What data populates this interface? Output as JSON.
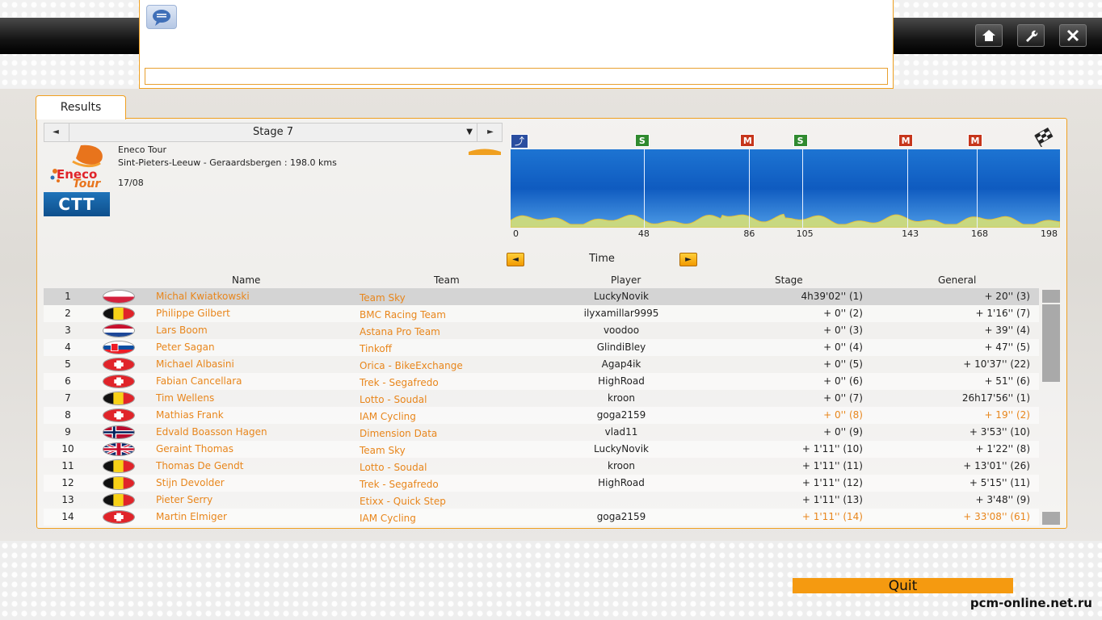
{
  "colors": {
    "accent": "#f0a020",
    "link": "#e8861c",
    "quit_bg": "#f59a10",
    "ctt_bg": "#1567aa"
  },
  "topbar": {
    "home_icon": "home-icon",
    "settings_icon": "wrench-icon",
    "close_icon": "close-icon"
  },
  "chat": {
    "icon": "chat-bubble-icon",
    "input_value": ""
  },
  "tabs": {
    "results": "Results"
  },
  "stage_selector": {
    "prev": "◄",
    "label": "Stage 7",
    "dropdown": "▼",
    "next": "►"
  },
  "race": {
    "logo_top": "Eneco",
    "logo_bottom": "Tour",
    "name": "Eneco Tour",
    "route": "Sint-Pieters-Leeuw - Geraardsbergen : 198.0 kms",
    "date": "17/08",
    "stage_type": "CTT"
  },
  "profile": {
    "markers": [
      {
        "type": "S",
        "km": 48
      },
      {
        "type": "M",
        "km": 86
      },
      {
        "type": "S",
        "km": 105
      },
      {
        "type": "M",
        "km": 143
      },
      {
        "type": "M",
        "km": 168
      }
    ],
    "km_labels": [
      "0",
      "48",
      "86",
      "105",
      "143",
      "168",
      "198"
    ],
    "start_icon": "time-trial-start-icon",
    "finish_icon": "checkered-flag-icon"
  },
  "classification": {
    "prev": "◄",
    "label": "Time",
    "next": "►"
  },
  "columns": {
    "name": "Name",
    "team": "Team",
    "player": "Player",
    "stage": "Stage",
    "general": "General"
  },
  "rows": [
    {
      "pos": "1",
      "flag": "PL",
      "name": "Michal Kwiatkowski",
      "team": "Team Sky",
      "player": "LuckyNovik",
      "stage": "4h39'02'' (1)",
      "general": "+ 20'' (3)",
      "highlight": false
    },
    {
      "pos": "2",
      "flag": "BE",
      "name": "Philippe Gilbert",
      "team": "BMC Racing Team",
      "player": "ilyxamillar9995",
      "stage": "+ 0'' (2)",
      "general": "+ 1'16'' (7)",
      "highlight": false
    },
    {
      "pos": "3",
      "flag": "NL",
      "name": "Lars Boom",
      "team": "Astana Pro Team",
      "player": "voodoo",
      "stage": "+ 0'' (3)",
      "general": "+ 39'' (4)",
      "highlight": false
    },
    {
      "pos": "4",
      "flag": "SK",
      "name": "Peter Sagan",
      "team": "Tinkoff",
      "player": "GlindiBley",
      "stage": "+ 0'' (4)",
      "general": "+ 47'' (5)",
      "highlight": false
    },
    {
      "pos": "5",
      "flag": "CH",
      "name": "Michael Albasini",
      "team": "Orica - BikeExchange",
      "player": "Agap4ik",
      "stage": "+ 0'' (5)",
      "general": "+ 10'37'' (22)",
      "highlight": false
    },
    {
      "pos": "6",
      "flag": "CH",
      "name": "Fabian Cancellara",
      "team": "Trek - Segafredo",
      "player": "HighRoad",
      "stage": "+ 0'' (6)",
      "general": "+ 51'' (6)",
      "highlight": false
    },
    {
      "pos": "7",
      "flag": "BE",
      "name": "Tim  Wellens",
      "team": "Lotto - Soudal",
      "player": "kroon",
      "stage": "+ 0'' (7)",
      "general": "26h17'56'' (1)",
      "highlight": false
    },
    {
      "pos": "8",
      "flag": "CH",
      "name": "Mathias Frank",
      "team": "IAM Cycling",
      "player": "goga2159",
      "stage": "+ 0'' (8)",
      "general": "+ 19'' (2)",
      "highlight": true
    },
    {
      "pos": "9",
      "flag": "NO",
      "name": "Edvald Boasson Hagen",
      "team": "Dimension Data",
      "player": "vlad11",
      "stage": "+ 0'' (9)",
      "general": "+ 3'53'' (10)",
      "highlight": false
    },
    {
      "pos": "10",
      "flag": "GB",
      "name": "Geraint Thomas",
      "team": "Team Sky",
      "player": "LuckyNovik",
      "stage": "+ 1'11'' (10)",
      "general": "+ 1'22'' (8)",
      "highlight": false
    },
    {
      "pos": "11",
      "flag": "BE",
      "name": "Thomas De Gendt",
      "team": "Lotto - Soudal",
      "player": "kroon",
      "stage": "+ 1'11'' (11)",
      "general": "+ 13'01'' (26)",
      "highlight": false
    },
    {
      "pos": "12",
      "flag": "BE",
      "name": "Stijn Devolder",
      "team": "Trek - Segafredo",
      "player": "HighRoad",
      "stage": "+ 1'11'' (12)",
      "general": "+ 5'15'' (11)",
      "highlight": false
    },
    {
      "pos": "13",
      "flag": "BE",
      "name": "Pieter Serry",
      "team": "Etixx - Quick Step",
      "player": "",
      "stage": "+ 1'11'' (13)",
      "general": "+ 3'48'' (9)",
      "highlight": false
    },
    {
      "pos": "14",
      "flag": "CH",
      "name": "Martin Elmiger",
      "team": "IAM Cycling",
      "player": "goga2159",
      "stage": "+ 1'11'' (14)",
      "general": "+ 33'08'' (61)",
      "highlight": true
    }
  ],
  "footer": {
    "quit": "Quit",
    "watermark": "pcm-online.net.ru"
  }
}
